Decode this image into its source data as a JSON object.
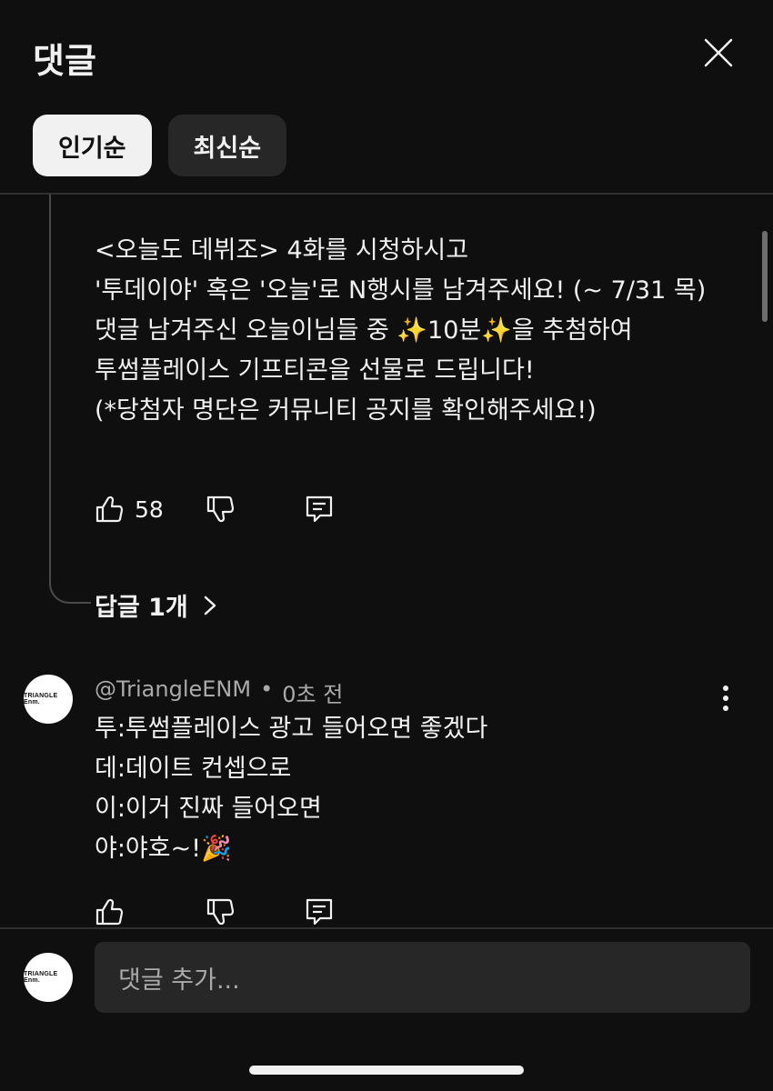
{
  "header": {
    "title": "댓글",
    "close_icon": "close-icon"
  },
  "sort_chips": [
    {
      "label": "인기순",
      "selected": true
    },
    {
      "label": "최신순",
      "selected": false
    }
  ],
  "pinned_comment": {
    "lines": [
      "<오늘도 데뷔조> 4화를 시청하시고",
      "'투데이야' 혹은 '오늘'로 N행시를 남겨주세요! (~ 7/31 목)",
      "댓글 남겨주신 오늘이님들 중 ✨10분✨을 추첨하여",
      "투썸플레이스 기프티콘을 선물로 드립니다!",
      "(*당첨자 명단은 커뮤니티 공지를 확인해주세요!)"
    ],
    "like_count": "58",
    "replies_label": "답글 1개"
  },
  "reply_comment": {
    "avatar_text": "TRIANGLE Enm.",
    "author": "@TriangleENM",
    "separator": "•",
    "timestamp": "0초 전",
    "lines": [
      "투:투썸플레이스 광고 들어오면 좋겠다",
      "데:데이트 컨셉으로",
      "이:이거 진짜 들어오면",
      "야:야호~!🎉"
    ]
  },
  "composer": {
    "avatar_text": "TRIANGLE Enm.",
    "placeholder": "댓글 추가..."
  },
  "colors": {
    "background": "#0f0f0f",
    "chip_active": "#f1f1f1",
    "chip_inactive": "#272727",
    "text_secondary": "#aaaaaa"
  }
}
